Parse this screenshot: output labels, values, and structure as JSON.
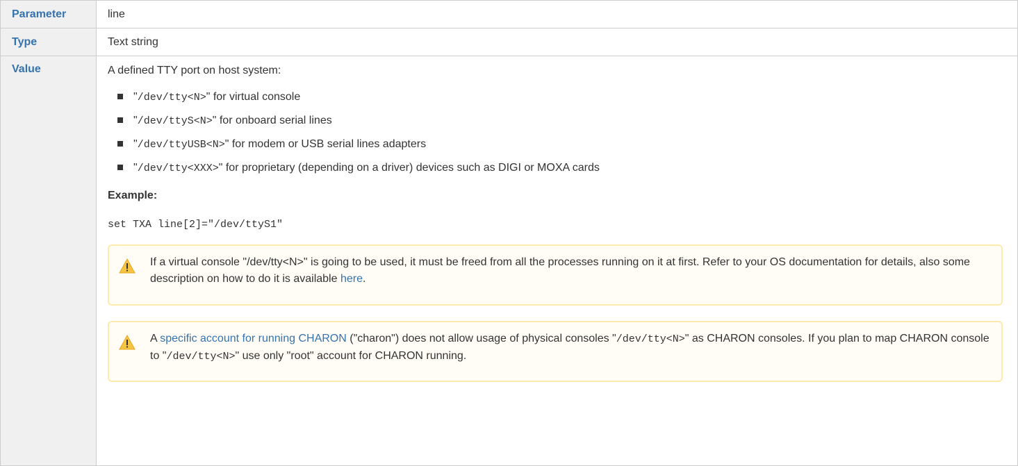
{
  "table": {
    "rows": {
      "parameter": {
        "label": "Parameter",
        "value": "line"
      },
      "type": {
        "label": "Type",
        "value": "Text string"
      },
      "value": {
        "label": "Value"
      }
    }
  },
  "value_section": {
    "intro": "A defined TTY port on host system:",
    "ports": [
      {
        "open_quote": "\"",
        "code": "/dev/tty<N>",
        "close": "\" for virtual console"
      },
      {
        "open_quote": "\"",
        "code": "/dev/ttyS<N>",
        "close": "\" for onboard serial lines"
      },
      {
        "open_quote": "\"",
        "code": "/dev/ttyUSB<N>",
        "close": "\" for modem or USB serial lines adapters"
      },
      {
        "open_quote": "\"",
        "code": "/dev/tty<XXX>",
        "close": "\" for proprietary (depending on a driver) devices such as DIGI or MOXA cards"
      }
    ],
    "example_label": "Example:",
    "example_code": "set TXA line[2]=\"/dev/ttyS1\"",
    "warning1": {
      "text_before": "If a virtual console \"/dev/tty<N>\" is going to be used, it must be freed from all the processes running on it at first. Refer to your OS documentation for details, also some description on how to do it is available ",
      "link": "here",
      "text_after": "."
    },
    "warning2": {
      "prefix": "A ",
      "link": "specific account for running CHARON",
      "mid1": " (\"charon\") does not allow usage of physical consoles \"",
      "code1": "/dev/tty<N>",
      "mid2": "\" as CHARON consoles. If you plan to map CHARON console to \"",
      "code2": "/dev/tty<N>",
      "suffix": "\" use only \"root\" account for CHARON running."
    }
  },
  "colors": {
    "header_bg": "#f0f0f0",
    "header_text": "#3572b0",
    "border": "#cccccc",
    "warning_bg": "#fffdf6",
    "warning_border": "#ffeaae",
    "warning_icon": "#f6c342",
    "link": "#3572b0"
  },
  "icons": {
    "warning": "warning-triangle-icon",
    "bullet": "square-bullet"
  }
}
